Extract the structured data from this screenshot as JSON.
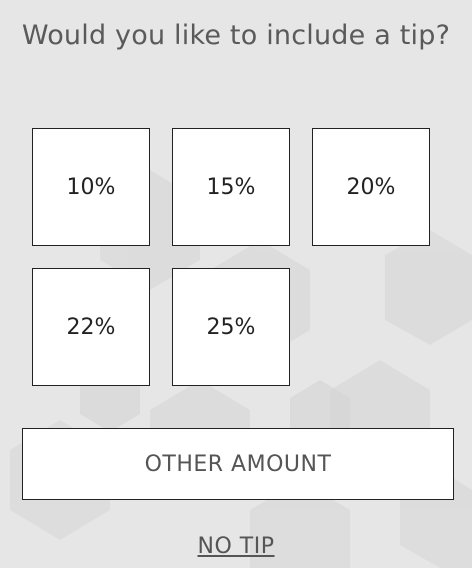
{
  "prompt": "Would you like to include a tip?",
  "tip_options": [
    {
      "label": "10%"
    },
    {
      "label": "15%"
    },
    {
      "label": "20%"
    },
    {
      "label": "22%"
    },
    {
      "label": "25%"
    }
  ],
  "other_amount_label": "OTHER AMOUNT",
  "no_tip_label": "NO TIP",
  "colors": {
    "background": "#e6e6e6",
    "pattern": "#dcdcdc",
    "text": "#5a5a5a",
    "border": "#222222",
    "tile": "#ffffff"
  }
}
